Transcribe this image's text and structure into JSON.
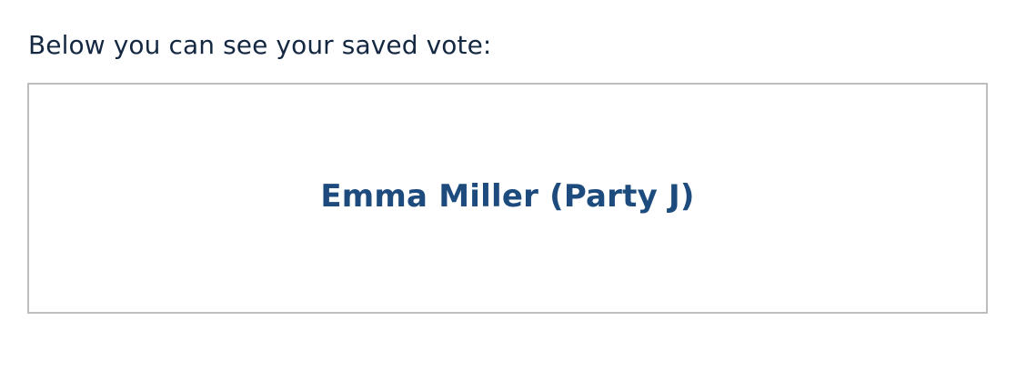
{
  "vote": {
    "intro": "Below you can see your saved vote:",
    "selection": "Emma Miller (Party J)"
  },
  "colors": {
    "text": "#142842",
    "accent": "#1e4b7d",
    "border": "#bdbdbd"
  }
}
